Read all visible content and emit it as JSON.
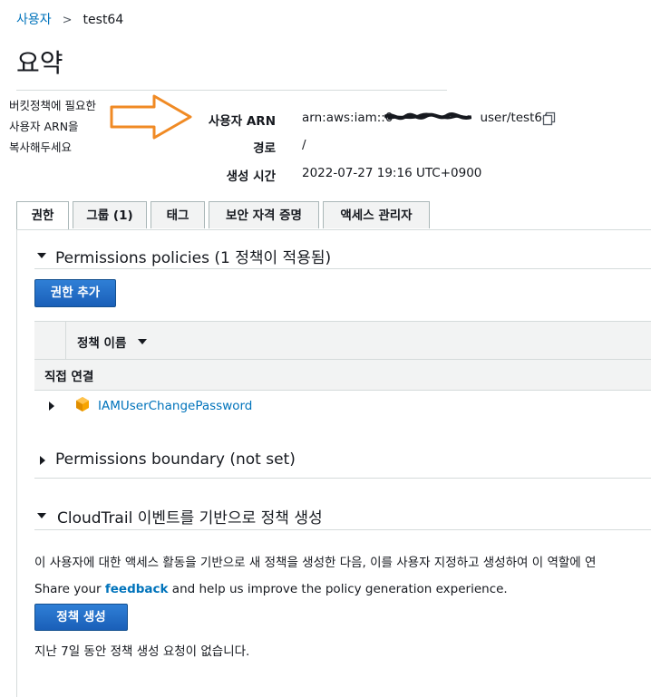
{
  "breadcrumb": {
    "parent": "사용자",
    "separator": ">",
    "current": "test64"
  },
  "page_title": "요약",
  "annotation": {
    "lines": [
      "버킷정책에 필요한",
      "사용자 ARN을",
      "복사해두세요"
    ],
    "arrow_color": "#f08a24"
  },
  "summary": {
    "arn_label": "사용자 ARN",
    "arn_prefix": "arn:aws:iam::0",
    "arn_suffix": "user/test64",
    "path_label": "경로",
    "path_value": "/",
    "created_label": "생성 시간",
    "created_value": "2022-07-27 19:16 UTC+0900"
  },
  "tabs": [
    {
      "label": "권한",
      "active": true
    },
    {
      "label": "그룹 (1)",
      "active": false
    },
    {
      "label": "태그",
      "active": false
    },
    {
      "label": "보안 자격 증명",
      "active": false
    },
    {
      "label": "액세스 관리자",
      "active": false
    }
  ],
  "permissions": {
    "heading": "Permissions policies (1 정책이 적용됨)",
    "add_button": "권한 추가",
    "column_header": "정책 이름",
    "group_label": "직접 연결",
    "policy_name": "IAMUserChangePassword"
  },
  "boundary": {
    "heading": "Permissions boundary (not set)"
  },
  "cloudtrail": {
    "heading": "CloudTrail 이벤트를 기반으로 정책 생성",
    "description": "이 사용자에 대한 액세스 활동을 기반으로 새 정책을 생성한 다음, 이를 사용자 지정하고 생성하여 이 역할에 연",
    "feedback_prefix": "Share your ",
    "feedback_link": "feedback",
    "feedback_suffix": " and help us improve the policy generation experience.",
    "generate_button": "정책 생성",
    "status": "지난 7일 동안 정책 생성 요청이 없습니다."
  },
  "colors": {
    "link": "#0073bb",
    "button": "#1a5fb8",
    "accent_icon": "#f7a400"
  }
}
